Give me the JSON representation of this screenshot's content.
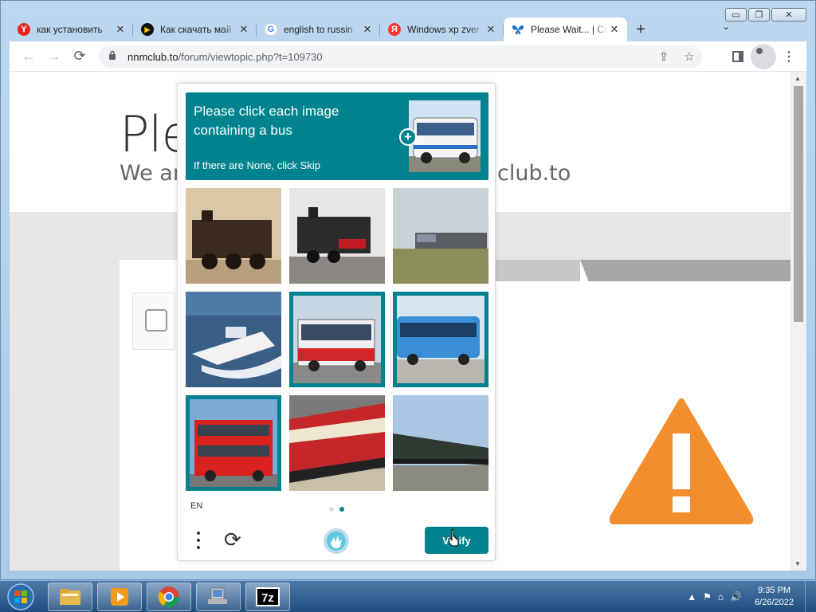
{
  "window": {
    "minimize": "▭",
    "restore": "❐",
    "close": "✕"
  },
  "tabs": [
    {
      "title": "как установить",
      "favicon": "yandex-icon",
      "favicon_text": "Y",
      "favicon_color": "#e52620",
      "active": false
    },
    {
      "title": "Как скачать май",
      "favicon": "play-icon",
      "favicon_text": "▶",
      "favicon_color": "#f5c400",
      "active": false
    },
    {
      "title": "english to russin",
      "favicon": "google-icon",
      "favicon_text": "G",
      "favicon_color": "#4285f4",
      "active": false
    },
    {
      "title": "Windows xp zver",
      "favicon": "yandex-icon",
      "favicon_text": "Я",
      "favicon_color": "#f33",
      "active": false
    },
    {
      "title": "Please Wait... | Cl",
      "favicon": "butterfly-icon",
      "favicon_text": "🦋",
      "favicon_color": "#ffffff",
      "active": true
    }
  ],
  "toolbar": {
    "new_tab": "+",
    "tab_search": "⌄",
    "back": "←",
    "forward": "→",
    "reload": "⟳",
    "url_host": "nnmclub.to",
    "url_path": "/forum/viewtopic.php?t=109730"
  },
  "page": {
    "heading": "Ple",
    "subtext_left": "We ar",
    "subtext_right": "club.to",
    "warning_color": "#f28e2b"
  },
  "captcha": {
    "prompt": "Please click each image containing a bus",
    "hint": "If there are None, click Skip",
    "language": "EN",
    "verify_label": "Verify",
    "accent": "#00838f",
    "tiles": [
      {
        "subject": "steam locomotive",
        "selected": false
      },
      {
        "subject": "steam locomotive",
        "selected": false
      },
      {
        "subject": "freight locomotive",
        "selected": false
      },
      {
        "subject": "motor boat",
        "selected": false
      },
      {
        "subject": "red bus",
        "selected": true
      },
      {
        "subject": "blue bus",
        "selected": true
      },
      {
        "subject": "double-decker bus",
        "selected": true
      },
      {
        "subject": "red train",
        "selected": false
      },
      {
        "subject": "freight train",
        "selected": false
      }
    ],
    "pages": 2,
    "current_page": 2
  },
  "taskbar": {
    "time": "9:35 PM",
    "date": "6/26/2022",
    "apps": [
      "explorer-icon",
      "media-player-icon",
      "chrome-icon",
      "computer-icon",
      "7zip-icon"
    ],
    "sevenzip_label": "7z"
  }
}
